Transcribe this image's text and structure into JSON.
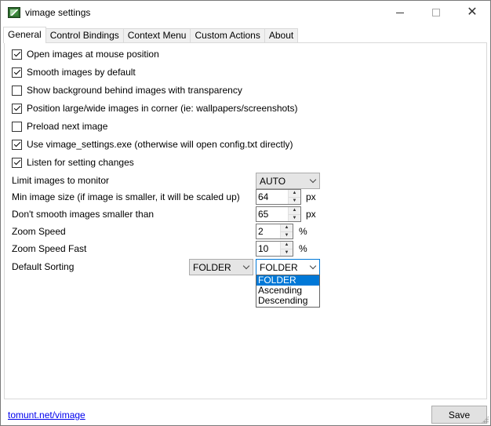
{
  "window": {
    "title": "vimage settings"
  },
  "tabs": [
    "General",
    "Control Bindings",
    "Context Menu",
    "Custom Actions",
    "About"
  ],
  "checkboxes": [
    {
      "label": "Open images at mouse position",
      "checked": true
    },
    {
      "label": "Smooth images by default",
      "checked": true
    },
    {
      "label": "Show background behind images with transparency",
      "checked": false
    },
    {
      "label": "Position large/wide images in corner (ie: wallpapers/screenshots)",
      "checked": true
    },
    {
      "label": "Preload next image",
      "checked": false
    },
    {
      "label": "Use vimage_settings.exe (otherwise will open config.txt directly)",
      "checked": true
    },
    {
      "label": "Listen for setting changes",
      "checked": true
    }
  ],
  "settings": {
    "limit_monitor": {
      "label": "Limit images to monitor",
      "value": "AUTO"
    },
    "min_size": {
      "label": "Min image size (if image is smaller, it will be scaled up)",
      "value": "64",
      "unit": "px"
    },
    "no_smooth": {
      "label": "Don't smooth images smaller than",
      "value": "65",
      "unit": "px"
    },
    "zoom_speed": {
      "label": "Zoom Speed",
      "value": "2",
      "unit": "%"
    },
    "zoom_fast": {
      "label": "Zoom Speed Fast",
      "value": "10",
      "unit": "%"
    },
    "sorting": {
      "label": "Default Sorting",
      "primary": "FOLDER",
      "secondary": "FOLDER"
    }
  },
  "sort_options": [
    "FOLDER",
    "Ascending",
    "Descending"
  ],
  "footer": {
    "link": "tomunt.net/vimage",
    "save": "Save"
  },
  "colors": {
    "accent": "#0078d7",
    "link": "#0000ee"
  }
}
